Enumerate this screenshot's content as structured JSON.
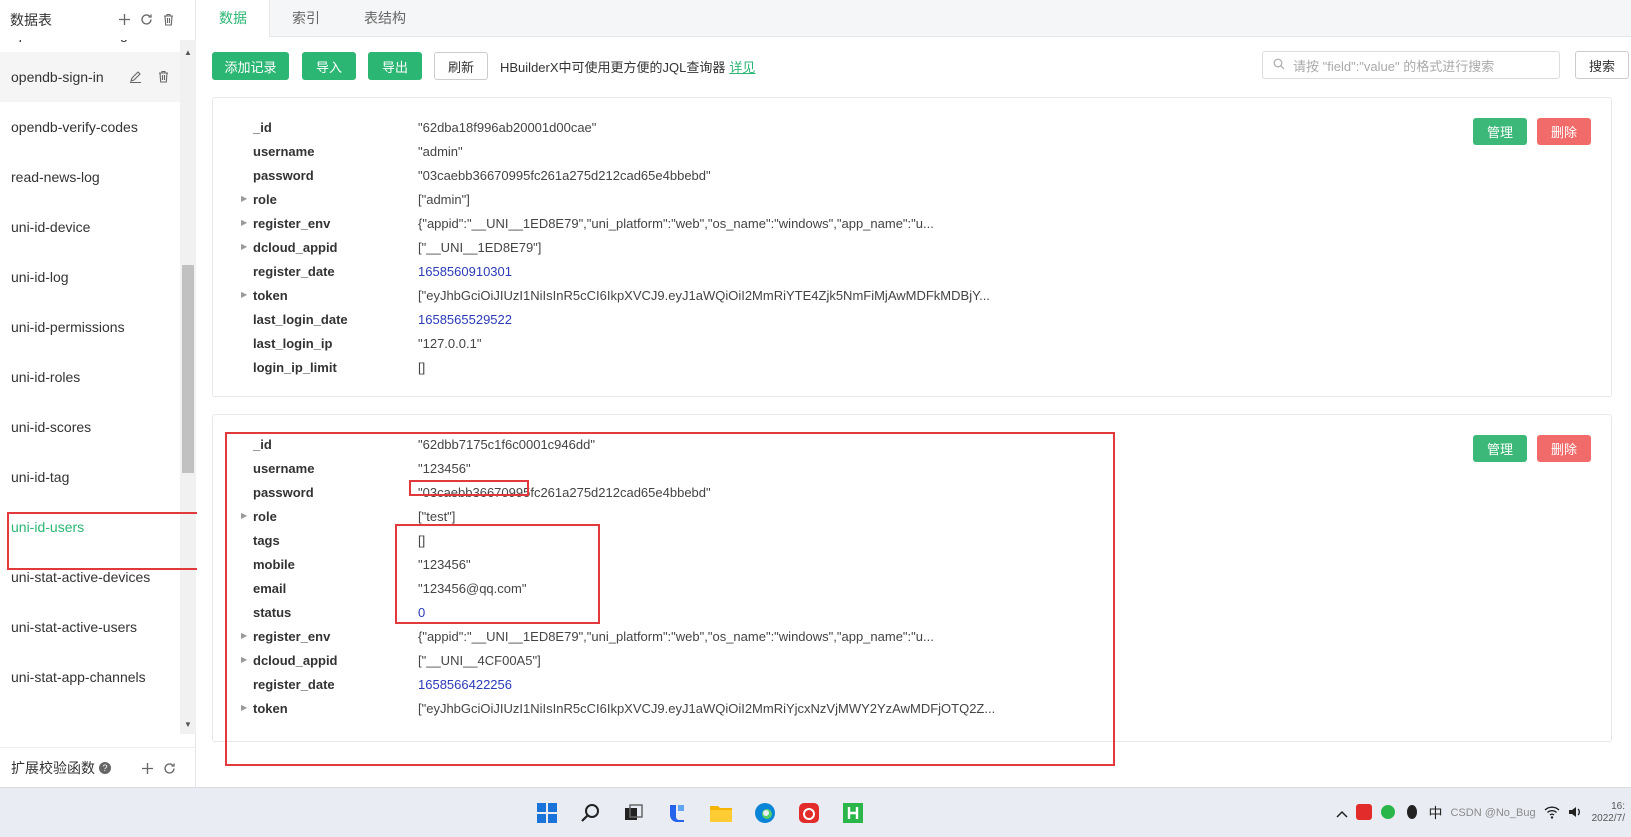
{
  "sidebar": {
    "title": "数据表",
    "items": [
      {
        "label": "opendb-search-log"
      },
      {
        "label": "opendb-sign-in"
      },
      {
        "label": "opendb-verify-codes"
      },
      {
        "label": "read-news-log"
      },
      {
        "label": "uni-id-device"
      },
      {
        "label": "uni-id-log"
      },
      {
        "label": "uni-id-permissions"
      },
      {
        "label": "uni-id-roles"
      },
      {
        "label": "uni-id-scores"
      },
      {
        "label": "uni-id-tag"
      },
      {
        "label": "uni-id-users"
      },
      {
        "label": "uni-stat-active-devices"
      },
      {
        "label": "uni-stat-active-users"
      },
      {
        "label": "uni-stat-app-channels"
      }
    ],
    "footer_label": "扩展校验函数",
    "help": "?"
  },
  "tabs": [
    {
      "label": "数据"
    },
    {
      "label": "索引"
    },
    {
      "label": "表结构"
    }
  ],
  "toolbar": {
    "add": "添加记录",
    "import": "导入",
    "export": "导出",
    "refresh": "刷新",
    "tip": "HBuilderX中可使用更方便的JQL查询器",
    "tip_link": "详见",
    "search_placeholder": "请按 \"field\":\"value\" 的格式进行搜索",
    "search_btn": "搜索"
  },
  "records": [
    {
      "fields": [
        {
          "key": "_id",
          "value": "\"62dba18f996ab20001d00cae\""
        },
        {
          "key": "username",
          "value": "\"admin\""
        },
        {
          "key": "password",
          "value": "\"03caebb36670995fc261a275d212cad65e4bbebd\""
        },
        {
          "key": "role",
          "value": "[\"admin\"]"
        },
        {
          "key": "register_env",
          "value": "{\"appid\":\"__UNI__1ED8E79\",\"uni_platform\":\"web\",\"os_name\":\"windows\",\"app_name\":\"u..."
        },
        {
          "key": "dcloud_appid",
          "value": "[\"__UNI__1ED8E79\"]"
        },
        {
          "key": "register_date",
          "value": "1658560910301"
        },
        {
          "key": "token",
          "value": "[\"eyJhbGciOiJIUzI1NiIsInR5cCI6IkpXVCJ9.eyJ1aWQiOiI2MmRiYTE4Zjk5NmFiMjAwMDFkMDBjY..."
        },
        {
          "key": "last_login_date",
          "value": "1658565529522"
        },
        {
          "key": "last_login_ip",
          "value": "\"127.0.0.1\""
        },
        {
          "key": "login_ip_limit",
          "value": "[]"
        }
      ]
    },
    {
      "fields": [
        {
          "key": "_id",
          "value": "\"62dbb7175c1f6c0001c946dd\""
        },
        {
          "key": "username",
          "value": "\"123456\""
        },
        {
          "key": "password",
          "value": "\"03caebb36670995fc261a275d212cad65e4bbebd\""
        },
        {
          "key": "role",
          "value": "[\"test\"]"
        },
        {
          "key": "tags",
          "value": "[]"
        },
        {
          "key": "mobile",
          "value": "\"123456\""
        },
        {
          "key": "email",
          "value": "\"123456@qq.com\""
        },
        {
          "key": "status",
          "value": "0"
        },
        {
          "key": "register_env",
          "value": "{\"appid\":\"__UNI__1ED8E79\",\"uni_platform\":\"web\",\"os_name\":\"windows\",\"app_name\":\"u..."
        },
        {
          "key": "dcloud_appid",
          "value": "[\"__UNI__4CF00A5\"]"
        },
        {
          "key": "register_date",
          "value": "1658566422256"
        },
        {
          "key": "token",
          "value": "[\"eyJhbGciOiJIUzI1NiIsInR5cCI6IkpXVCJ9.eyJ1aWQiOiI2MmRiYjcxNzVjMWY2YzAwMDFjOTQ2Z..."
        }
      ]
    }
  ],
  "actions": {
    "manage": "管理",
    "delete": "删除"
  },
  "taskbar": {
    "ime": "中",
    "watermark": "CSDN @No_Bug",
    "time": "16:",
    "date": "2022/7/"
  },
  "colors": {
    "accent": "#2bb673",
    "danger": "#f26b6b",
    "highlight": "#e4393c",
    "number": "#2b3ab8"
  }
}
